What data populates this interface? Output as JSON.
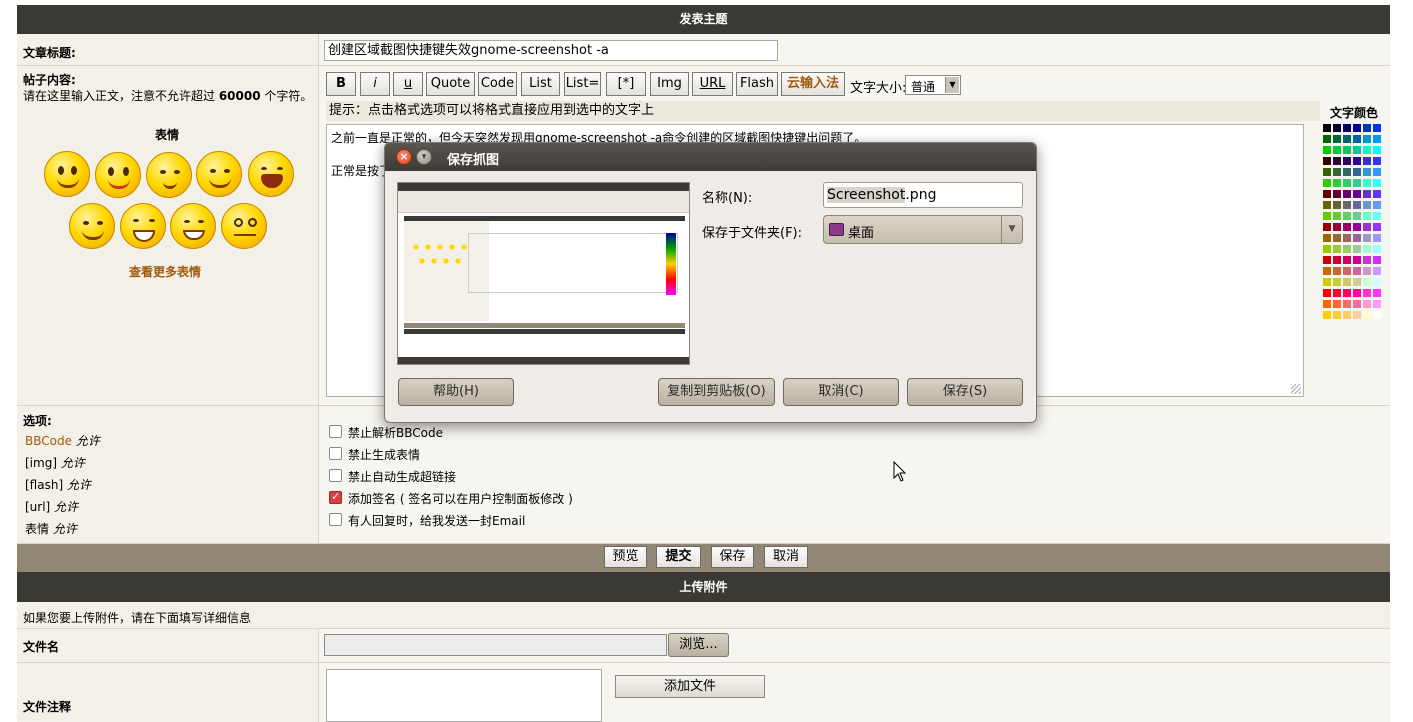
{
  "post_section": {
    "header": "发表主题",
    "title_label": "文章标题:",
    "title_value": "创建区域截图快捷键失效gnome-screenshot -a",
    "content_label": "帖子内容:",
    "content_hint_pre": "请在这里输入正文，注意不允许超过 ",
    "content_hint_num": "60000",
    "content_hint_post": " 个字符。",
    "emoticons_label": "表情",
    "more_emoticons": "查看更多表情",
    "format_buttons": [
      "B",
      "i",
      "u",
      "Quote",
      "Code",
      "List",
      "List=",
      "[*]",
      "Img",
      "URL",
      "Flash",
      "云输入法"
    ],
    "font_size_label": "文字大小:",
    "font_size_value": "普通",
    "format_hint": "提示：点击格式选项可以将格式直接应用到选中的文字上",
    "text_color_label": "文字颜色",
    "body_line1": "之前一直是正常的，但今天突然发现用gnome-screenshot -a命令创建的区域截图快捷键出问题了。",
    "body_line2": "正常是按了"
  },
  "options": {
    "label": "选项:",
    "allow_items": [
      {
        "name": "BBCode",
        "state": "允许"
      },
      {
        "name": "[img]",
        "state": "允许"
      },
      {
        "name": "[flash]",
        "state": "允许"
      },
      {
        "name": "[url]",
        "state": "允许"
      },
      {
        "name": "表情",
        "state": "允许"
      }
    ],
    "checkboxes": [
      {
        "label": "禁止解析BBCode",
        "checked": false
      },
      {
        "label": "禁止生成表情",
        "checked": false
      },
      {
        "label": "禁止自动生成超链接",
        "checked": false
      },
      {
        "label": "添加签名 ( 签名可以在用户控制面板修改 )",
        "checked": true
      },
      {
        "label": "有人回复时，给我发送一封Email",
        "checked": false
      }
    ]
  },
  "submit_buttons": [
    "预览",
    "提交",
    "保存",
    "取消"
  ],
  "upload_section": {
    "header": "上传附件",
    "intro": "如果您要上传附件，请在下面填写详细信息",
    "file_label": "文件名",
    "browse_button": "浏览...",
    "comment_label": "文件注释",
    "add_file_button": "添加文件"
  },
  "dialog": {
    "title": "保存抓图",
    "name_label": "名称(N):",
    "name_value_selected": "Screenshot",
    "name_value_ext": ".png",
    "folder_label": "保存于文件夹(F):",
    "folder_value": "桌面",
    "help_button": "帮助(H)",
    "copy_button": "复制到剪贴板(O)",
    "cancel_button": "取消(C)",
    "save_button": "保存(S)"
  },
  "colors": {
    "dark_bar": "#3b3935",
    "submit_bar": "#928675",
    "accent_link": "#a35a0e"
  }
}
